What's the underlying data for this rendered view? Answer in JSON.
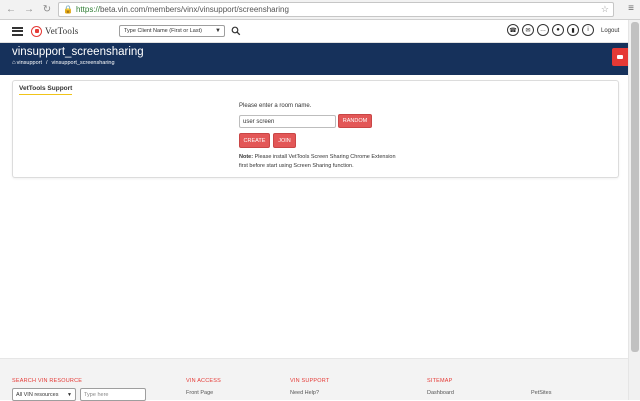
{
  "browser": {
    "url_scheme": "https://",
    "url_rest": "beta.vin.com/members/vinx/vinsupport/screensharing"
  },
  "header": {
    "logo_text": "VetTools",
    "client_select_placeholder": "Type Client Name (First or Last)",
    "logout_label": "Logout",
    "icons": [
      "phone-icon",
      "email-icon",
      "chat-icon",
      "notification-icon",
      "microphone-icon",
      "info-icon"
    ]
  },
  "title_bar": {
    "title": "vinsupport_screensharing",
    "breadcrumb": [
      "vinsupport",
      "vinsupport_screensharing"
    ]
  },
  "card": {
    "title": "VetTools Support",
    "room_label": "Please enter a room name.",
    "room_input_value": "user screen",
    "random_button": "RANDOM",
    "create_button": "CREATE",
    "join_button": "JOIN",
    "note_label": "Note:",
    "note_text": "Please install VetTools Screen Sharing Chrome Extension first before start using Screen Sharing function."
  },
  "footer": {
    "search_heading": "SEARCH VIN RESOURCE",
    "search_select_value": "All VIN resources",
    "search_placeholder": "Type here",
    "access_heading": "VIN ACCESS",
    "access_link": "Front Page",
    "support_heading": "VIN SUPPORT",
    "support_link": "Need Help?",
    "sitemap_heading": "SITEMAP",
    "sitemap_link_1": "Dashboard",
    "sitemap_link_2": "PetSites"
  },
  "colors": {
    "navy": "#16315b",
    "accent_red": "#e53935",
    "button_red": "#e35757",
    "underline_yellow": "#f0c419"
  }
}
